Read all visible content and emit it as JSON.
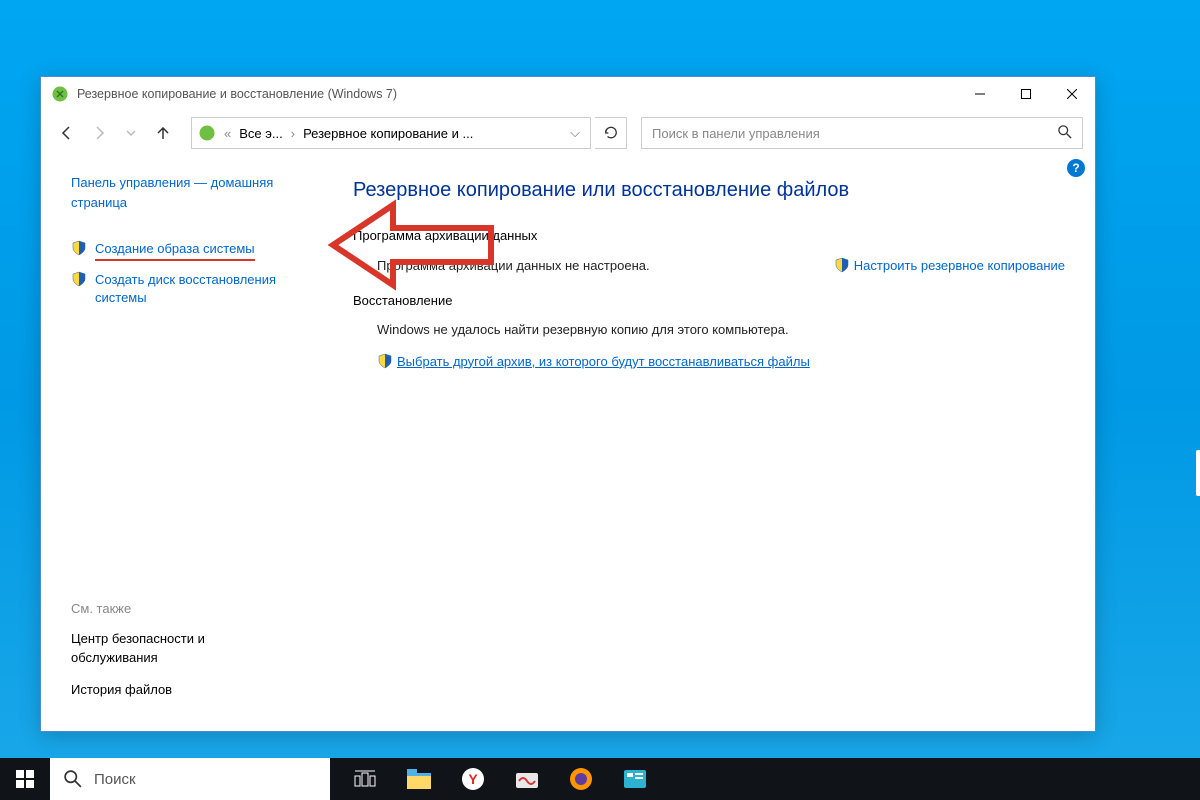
{
  "window": {
    "title": "Резервное копирование и восстановление (Windows 7)"
  },
  "address": {
    "crumb1": "Все э...",
    "crumb2": "Резервное копирование и ..."
  },
  "search": {
    "placeholder": "Поиск в панели управления"
  },
  "sidebar": {
    "home": "Панель управления — домашняя страница",
    "link1": "Создание образа системы",
    "link2": "Создать диск восстановления системы",
    "seealso": "См. также",
    "bottom1": "Центр безопасности и обслуживания",
    "bottom2": "История файлов"
  },
  "main": {
    "heading": "Резервное копирование или восстановление файлов",
    "section1": "Программа архивации данных",
    "status1": "Программа архивации данных не настроена.",
    "action1": "Настроить резервное копирование",
    "section2": "Восстановление",
    "status2": "Windows не удалось найти резервную копию для этого компьютера.",
    "action2": "Выбрать другой архив, из которого будут восстанавливаться файлы"
  },
  "taskbar": {
    "search": "Поиск"
  }
}
